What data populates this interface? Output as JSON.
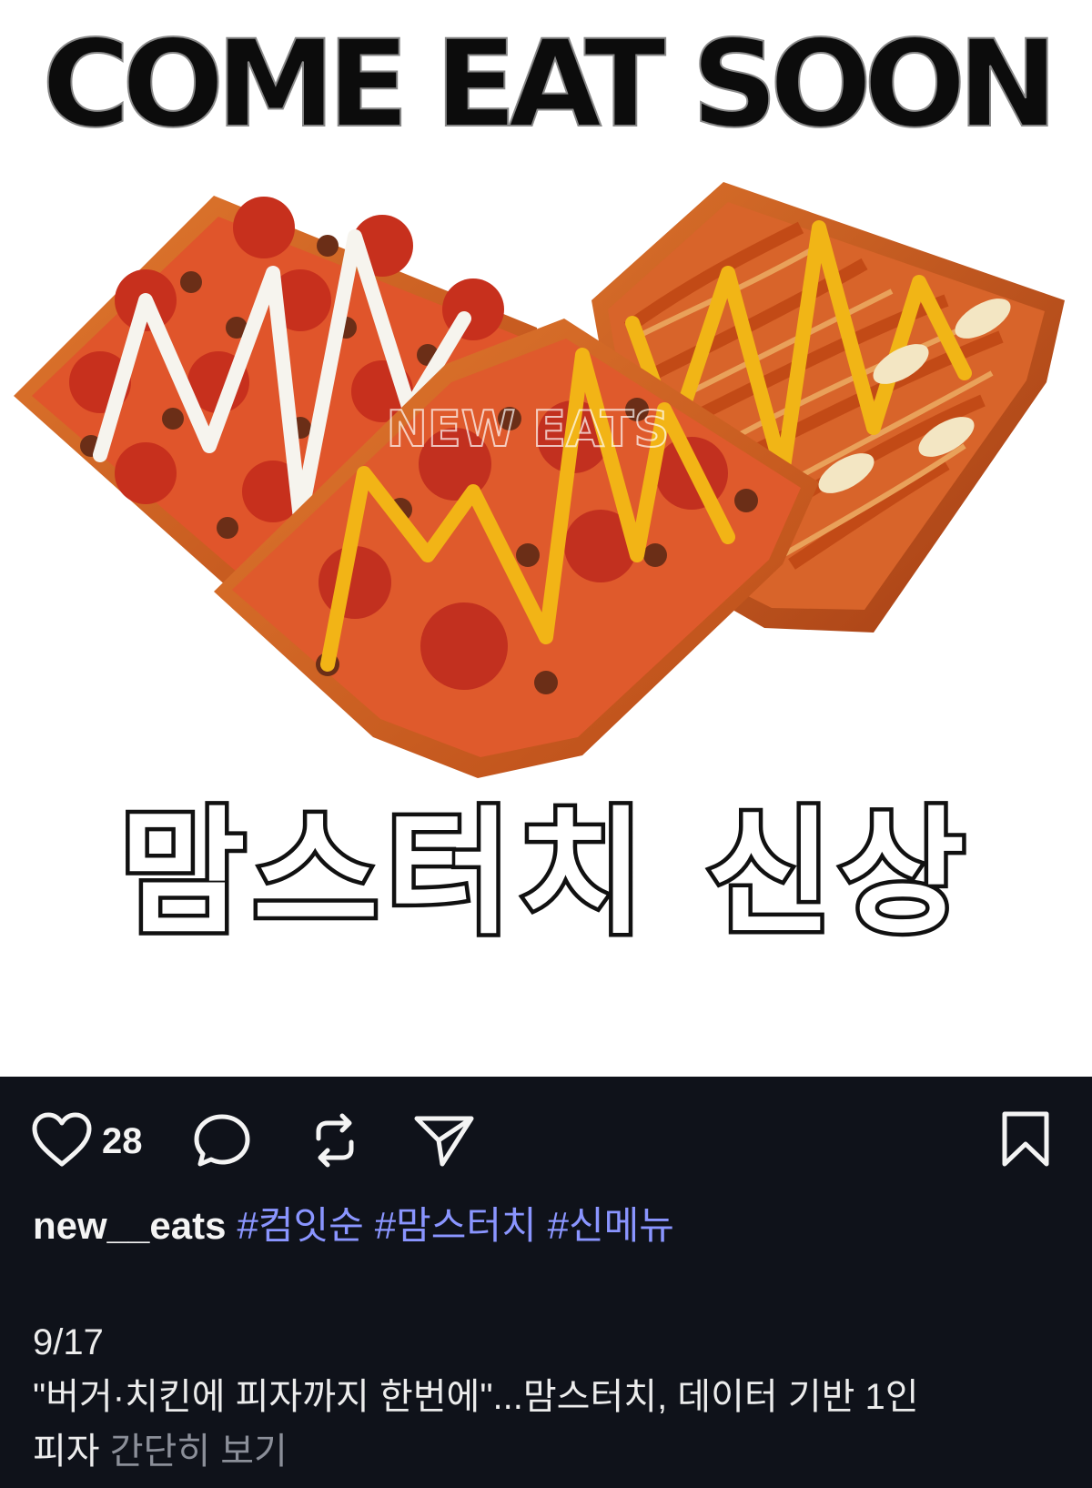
{
  "image": {
    "headline": "COME EAT SOON",
    "overlay_text": "맘스터치 신상",
    "watermark": "NEW EATS"
  },
  "actions": {
    "like_icon": "heart-icon",
    "like_count": "28",
    "comment_icon": "comment-icon",
    "repost_icon": "repost-icon",
    "share_icon": "send-icon",
    "save_icon": "bookmark-icon"
  },
  "caption": {
    "username": "new__eats",
    "hashtags": [
      "#컴잇순",
      "#맘스터치",
      "#신메뉴"
    ],
    "date": "9/17",
    "body": "\"버거·치킨에 피자까지 한번에\"...맘스터치, 데이터 기반 1인",
    "body_cont": "피자",
    "more_label": "간단히 보기"
  },
  "colors": {
    "footer_bg": "#0f121a",
    "hashtag": "#8a95ff",
    "muted": "#8b8f99"
  }
}
